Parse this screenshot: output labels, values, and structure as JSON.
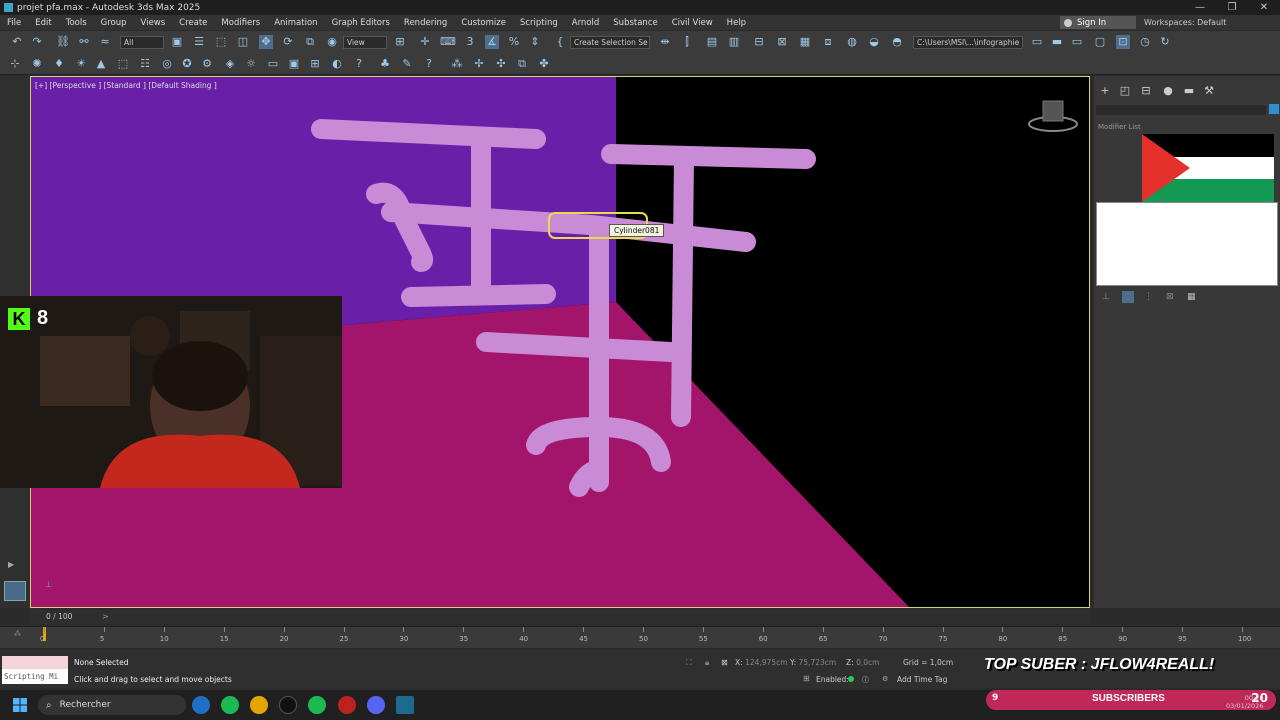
{
  "window": {
    "title": "projet pfa.max - Autodesk 3ds Max 2025",
    "controls": [
      "—",
      "❐",
      "✕"
    ]
  },
  "menu": [
    "File",
    "Edit",
    "Tools",
    "Group",
    "Views",
    "Create",
    "Modifiers",
    "Animation",
    "Graph Editors",
    "Rendering",
    "Customize",
    "Scripting",
    "Arnold",
    "Substance",
    "Civil View",
    "Help"
  ],
  "account": {
    "sign_in": "Sign In",
    "workspaces_label": "Workspaces:",
    "workspace_value": "Default"
  },
  "toolbar": {
    "filter_dropdown": "All",
    "view_dropdown": "View",
    "selection_set": "Create Selection Se",
    "project_path": "C:\\Users\\MSI\\...\\infographie"
  },
  "viewport": {
    "label": "[+] [Perspective ] [Standard ] [Default Shading ]",
    "tooltip": "Cylinder081",
    "colors": {
      "bg_left": "#6a1fa8",
      "bg_right": "#000000",
      "floor": "#a3156b",
      "pipe": "#c98ad6"
    }
  },
  "command_panel": {
    "modifier_list": "Modifier List",
    "flag_colors": {
      "top": "#000000",
      "middle": "#ffffff",
      "bottom": "#149954",
      "triangle": "#e4312b"
    }
  },
  "webcam": {
    "kick_glyph": "K",
    "kick_count": "8"
  },
  "timeline": {
    "frame_counter": "0 / 100",
    "ticks": [
      "0",
      "5",
      "10",
      "15",
      "20",
      "25",
      "30",
      "35",
      "40",
      "45",
      "50",
      "55",
      "60",
      "65",
      "70",
      "75",
      "80",
      "85",
      "90",
      "95",
      "100"
    ]
  },
  "status": {
    "script_listener": "Scripting Mi",
    "selection": "None Selected",
    "prompt": "Click and drag to select and move objects",
    "x_label": "X:",
    "x_value": "124,975cm",
    "y_label": "Y:",
    "y_value": "75,723cm",
    "z_label": "Z:",
    "z_value": "0,0cm",
    "grid": "Grid = 1,0cm",
    "enabled": "Enabled:",
    "add_time_tag": "Add Time Tag"
  },
  "taskbar": {
    "search_placeholder": "Rechercher"
  },
  "overlay": {
    "banner": "TOP SUBER : JFLOW4REALL!",
    "sub_left": "9",
    "sub_label": "SUBSCRIBERS",
    "sub_right": "20",
    "clock_time": "00:20",
    "clock_date": "03/01/2026"
  }
}
